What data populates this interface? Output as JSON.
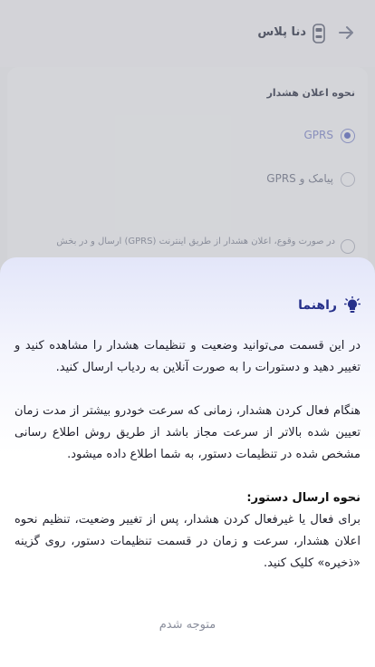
{
  "header": {
    "car_name": "دنا پلاس"
  },
  "settings": {
    "section_title": "نحوه اعلان هشدار",
    "options": [
      {
        "label": "GPRS",
        "selected": true
      },
      {
        "label": "پیامک و GPRS",
        "selected": false
      }
    ],
    "info_text": "در صورت وقوع، اعلان هشدار از طریق اینترنت (GPRS) ارسال و در بخش"
  },
  "sheet": {
    "title": "راهنما",
    "paragraph1": "در این قسمت می‌توانید وضعیت و تنظیمات هشدار را مشاهده کنید و تغییر دهید و دستورات را به صورت آنلاین به ردیاب ارسال کنید.",
    "paragraph2": "هنگام فعال کردن هشدار، زمانی که سرعت خودرو بیشتر از مدت زمان تعیین شده بالاتر از سرعت مجاز باشد از طریق روش اطلاع رسانی مشخص شده در تنظیمات دستور، به شما اطلاع داده میشود.",
    "command_title": "نحوه ارسال دستور:",
    "paragraph3": "برای فعال یا غیرفعال کردن هشدار، پس از تغییر وضعیت، تنظیم نحوه اعلان هشدار، سرعت و زمان در قسمت تنظیمات دستور، روی گزینه «ذخیره» کلیک کنید.",
    "confirm_label": "متوجه شدم"
  },
  "colors": {
    "accent": "#26308a",
    "radio_selected": "#7e89cf",
    "overlay": "#3c3e48"
  },
  "icons": {
    "back": "arrow-right-icon",
    "car": "car-icon",
    "bulb": "lightbulb-icon",
    "info": "info-icon"
  }
}
